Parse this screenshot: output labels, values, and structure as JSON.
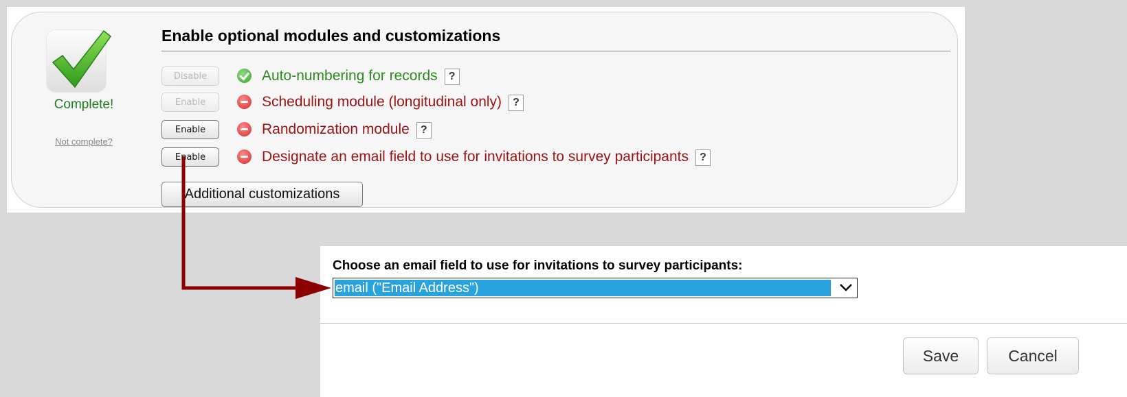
{
  "module_panel": {
    "status_complete": "Complete!",
    "not_complete_link": "Not complete?",
    "title": "Enable optional modules and customizations",
    "rows": [
      {
        "button": "Disable",
        "button_enabled": false,
        "status": "enabled",
        "label": "Auto-numbering for records",
        "help": "?"
      },
      {
        "button": "Enable",
        "button_enabled": false,
        "status": "disabled",
        "label": "Scheduling module (longitudinal only)",
        "help": "?"
      },
      {
        "button": "Enable",
        "button_enabled": true,
        "status": "disabled",
        "label": "Randomization module",
        "help": "?"
      },
      {
        "button": "Enable",
        "button_enabled": true,
        "status": "disabled",
        "label": "Designate an email field to use for invitations to survey participants",
        "help": "?"
      }
    ],
    "additional_button": "Additional customizations"
  },
  "email_dialog": {
    "label": "Choose an email field to use for invitations to survey participants:",
    "selected_option": "email (\"Email Address\")",
    "save_label": "Save",
    "cancel_label": "Cancel"
  },
  "colors": {
    "enabled_text": "#2d8a1e",
    "disabled_text": "#9b1212",
    "select_highlight": "#29a3dd",
    "arrow": "#8b0000"
  },
  "icons": {
    "complete": "checkmark-icon",
    "enabled_status": "green-check-circle-icon",
    "disabled_status": "red-minus-circle-icon",
    "dropdown": "chevron-down-icon"
  }
}
